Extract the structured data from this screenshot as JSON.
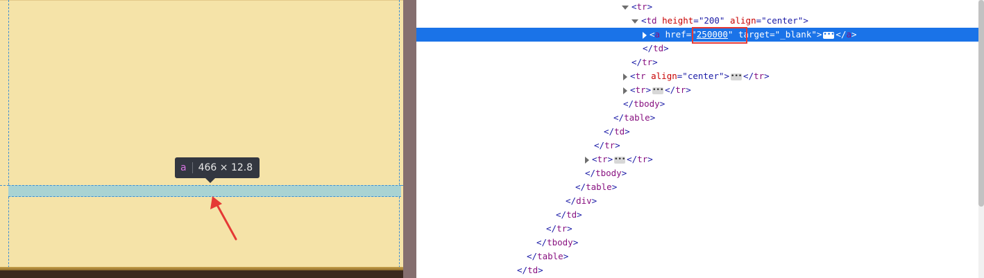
{
  "preview": {
    "tooltip_tag": "a",
    "tooltip_size": "466 × 12.8"
  },
  "colors": {
    "page_bg": "#f5e3a8",
    "highlight": "#a9d3d3",
    "guide": "#3a8fd6",
    "selected_row": "#1a73e8",
    "annotation_red": "#e53935"
  },
  "devtools": {
    "lines": [
      {
        "indent": 296,
        "toggle": "down",
        "parts": [
          [
            "b",
            "<"
          ],
          [
            "t",
            "tr"
          ],
          [
            "b",
            ">"
          ]
        ]
      },
      {
        "indent": 310,
        "toggle": "down",
        "parts": [
          [
            "b",
            "<"
          ],
          [
            "t",
            "td"
          ],
          [
            "b",
            " "
          ],
          [
            "a",
            "height"
          ],
          [
            "b",
            "="
          ],
          [
            "v",
            "\"200\""
          ],
          [
            "b",
            " "
          ],
          [
            "a",
            "align"
          ],
          [
            "b",
            "="
          ],
          [
            "v",
            "\"center\""
          ],
          [
            "b",
            ">"
          ]
        ]
      },
      {
        "indent": 326,
        "toggle": "right",
        "selected": true,
        "parts": [
          [
            "b",
            "<"
          ],
          [
            "t",
            "a"
          ],
          [
            "b",
            " "
          ],
          [
            "a",
            "href"
          ],
          [
            "b",
            "="
          ],
          [
            "v",
            "\""
          ],
          [
            "vu",
            "250000"
          ],
          [
            "v",
            "\""
          ],
          [
            "b",
            " "
          ],
          [
            "a",
            "target"
          ],
          [
            "b",
            "="
          ],
          [
            "v",
            "\"_blank\""
          ],
          [
            "b",
            ">"
          ],
          [
            "e",
            ""
          ],
          [
            "b",
            "</"
          ],
          [
            "t",
            "a"
          ],
          [
            "b",
            ">"
          ]
        ]
      },
      {
        "indent": 326,
        "parts": [
          [
            "b",
            "</"
          ],
          [
            "t",
            "td"
          ],
          [
            "b",
            ">"
          ]
        ]
      },
      {
        "indent": 310,
        "parts": [
          [
            "b",
            "</"
          ],
          [
            "t",
            "tr"
          ],
          [
            "b",
            ">"
          ]
        ]
      },
      {
        "indent": 298,
        "toggle": "right",
        "parts": [
          [
            "b",
            "<"
          ],
          [
            "t",
            "tr"
          ],
          [
            "b",
            " "
          ],
          [
            "a",
            "align"
          ],
          [
            "b",
            "="
          ],
          [
            "v",
            "\"center\""
          ],
          [
            "b",
            ">"
          ],
          [
            "e",
            ""
          ],
          [
            "b",
            "</"
          ],
          [
            "t",
            "tr"
          ],
          [
            "b",
            ">"
          ]
        ]
      },
      {
        "indent": 298,
        "toggle": "right",
        "parts": [
          [
            "b",
            "<"
          ],
          [
            "t",
            "tr"
          ],
          [
            "b",
            ">"
          ],
          [
            "e",
            ""
          ],
          [
            "b",
            "</"
          ],
          [
            "t",
            "tr"
          ],
          [
            "b",
            ">"
          ]
        ]
      },
      {
        "indent": 298,
        "parts": [
          [
            "b",
            "</"
          ],
          [
            "t",
            "tbody"
          ],
          [
            "b",
            ">"
          ]
        ]
      },
      {
        "indent": 284,
        "parts": [
          [
            "b",
            "</"
          ],
          [
            "t",
            "table"
          ],
          [
            "b",
            ">"
          ]
        ]
      },
      {
        "indent": 270,
        "parts": [
          [
            "b",
            "</"
          ],
          [
            "t",
            "td"
          ],
          [
            "b",
            ">"
          ]
        ]
      },
      {
        "indent": 256,
        "parts": [
          [
            "b",
            "</"
          ],
          [
            "t",
            "tr"
          ],
          [
            "b",
            ">"
          ]
        ]
      },
      {
        "indent": 243,
        "toggle": "right",
        "parts": [
          [
            "b",
            "<"
          ],
          [
            "t",
            "tr"
          ],
          [
            "b",
            ">"
          ],
          [
            "e",
            ""
          ],
          [
            "b",
            "</"
          ],
          [
            "t",
            "tr"
          ],
          [
            "b",
            ">"
          ]
        ]
      },
      {
        "indent": 243,
        "parts": [
          [
            "b",
            "</"
          ],
          [
            "t",
            "tbody"
          ],
          [
            "b",
            ">"
          ]
        ]
      },
      {
        "indent": 229,
        "parts": [
          [
            "b",
            "</"
          ],
          [
            "t",
            "table"
          ],
          [
            "b",
            ">"
          ]
        ]
      },
      {
        "indent": 215,
        "parts": [
          [
            "b",
            "</"
          ],
          [
            "t",
            "div"
          ],
          [
            "b",
            ">"
          ]
        ]
      },
      {
        "indent": 201,
        "parts": [
          [
            "b",
            "</"
          ],
          [
            "t",
            "td"
          ],
          [
            "b",
            ">"
          ]
        ]
      },
      {
        "indent": 187,
        "parts": [
          [
            "b",
            "</"
          ],
          [
            "t",
            "tr"
          ],
          [
            "b",
            ">"
          ]
        ]
      },
      {
        "indent": 173,
        "parts": [
          [
            "b",
            "</"
          ],
          [
            "t",
            "tbody"
          ],
          [
            "b",
            ">"
          ]
        ]
      },
      {
        "indent": 159,
        "parts": [
          [
            "b",
            "</"
          ],
          [
            "t",
            "table"
          ],
          [
            "b",
            ">"
          ]
        ]
      },
      {
        "indent": 145,
        "parts": [
          [
            "b",
            "</"
          ],
          [
            "t",
            "td"
          ],
          [
            "b",
            ">"
          ]
        ]
      }
    ]
  }
}
